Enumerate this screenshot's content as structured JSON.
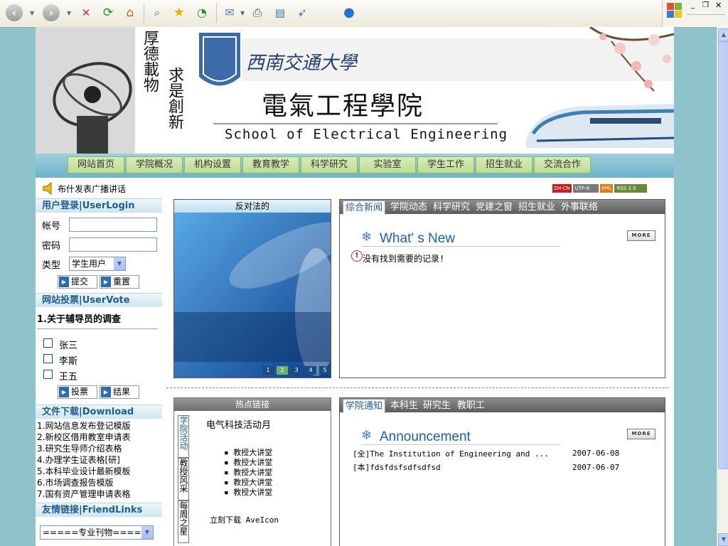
{
  "browser": {
    "toolbar_icons": [
      "back-icon",
      "forward-icon",
      "stop-icon",
      "refresh-icon",
      "home-icon",
      "search-icon",
      "favorites-icon",
      "history-icon",
      "mail-icon",
      "print-icon",
      "edit-icon",
      "messenger-icon",
      "apple-icon"
    ]
  },
  "banner": {
    "motto_left": "厚德載物",
    "motto_right": "求是創新",
    "university": "西南交通大學",
    "college_cn": "電氣工程學院",
    "college_en": "School of Electrical Engineering"
  },
  "nav": {
    "items": [
      "网站首页",
      "学院概况",
      "机构设置",
      "教育教学",
      "科学研究",
      "实验室",
      "学生工作",
      "招生就业",
      "交流合作"
    ]
  },
  "announcement_bar": {
    "text": "布什发表广播讲话"
  },
  "badges": {
    "zh": "ZH-CN",
    "utf": "UTF-8",
    "xml": "XML",
    "rss": "RSS 2.0"
  },
  "login": {
    "heading": "用户登录|UserLogin",
    "account_label": "帐号",
    "password_label": "密码",
    "type_label": "类型",
    "type_value": "学生用户",
    "submit": "提交",
    "reset": "重置"
  },
  "vote": {
    "heading": "网站投票|UserVote",
    "question": "1.关于辅导员的调查",
    "options": [
      "张三",
      "李斯",
      "王五"
    ],
    "vote_btn": "投票",
    "result_btn": "结果"
  },
  "downloads": {
    "heading": "文件下载|Download",
    "items": [
      "1.网站信息发布登记模版",
      "2.新校区借用教室申请表",
      "3.研究生导师介绍表格",
      "4.办理学生证表格[研]",
      "5.本科毕业设计最新模板",
      "6.市场调查报告模版",
      "7.国有资产管理申请表格"
    ]
  },
  "friendlinks": {
    "heading": "友情链接|FriendLinks",
    "select_value": "=====专业刊物====="
  },
  "feature": {
    "title": "反对法的",
    "pages": [
      "1",
      "2",
      "3",
      "4",
      "5"
    ],
    "active_page": "2"
  },
  "news": {
    "tabs": [
      "综合新闻",
      "学院动态",
      "科学研究",
      "党建之窗",
      "招生就业",
      "外事联络"
    ],
    "section_title": "What' s New",
    "more": "MORE",
    "empty_msg": "没有找到需要的记录!"
  },
  "hotlinks": {
    "heading": "热点链接",
    "side_tabs": [
      "学院活动",
      "教授风采",
      "每周之星"
    ],
    "title": "电气科技活动月",
    "items": [
      "教授大讲堂",
      "教授大讲堂",
      "教授大讲堂",
      "教授大讲堂",
      "教授大讲堂"
    ],
    "download_text": "立刻下载 AveIcon"
  },
  "notice": {
    "tabs": [
      "学院通知",
      "本科生",
      "研究生",
      "教职工"
    ],
    "section_title": "Announcement",
    "more": "MORE",
    "rows": [
      {
        "title": "[全]The Institution of Engineering and ...",
        "date": "2007-06-08"
      },
      {
        "title": "[本]fdsfdsfsdfsdfsd",
        "date": "2007-06-07"
      }
    ]
  },
  "colors": {
    "page_bg": "#8ec3cb",
    "nav_bg": "#6fb2c8",
    "heading_blue": "#1f5b95",
    "tab_gray": "#6d6d6d"
  }
}
